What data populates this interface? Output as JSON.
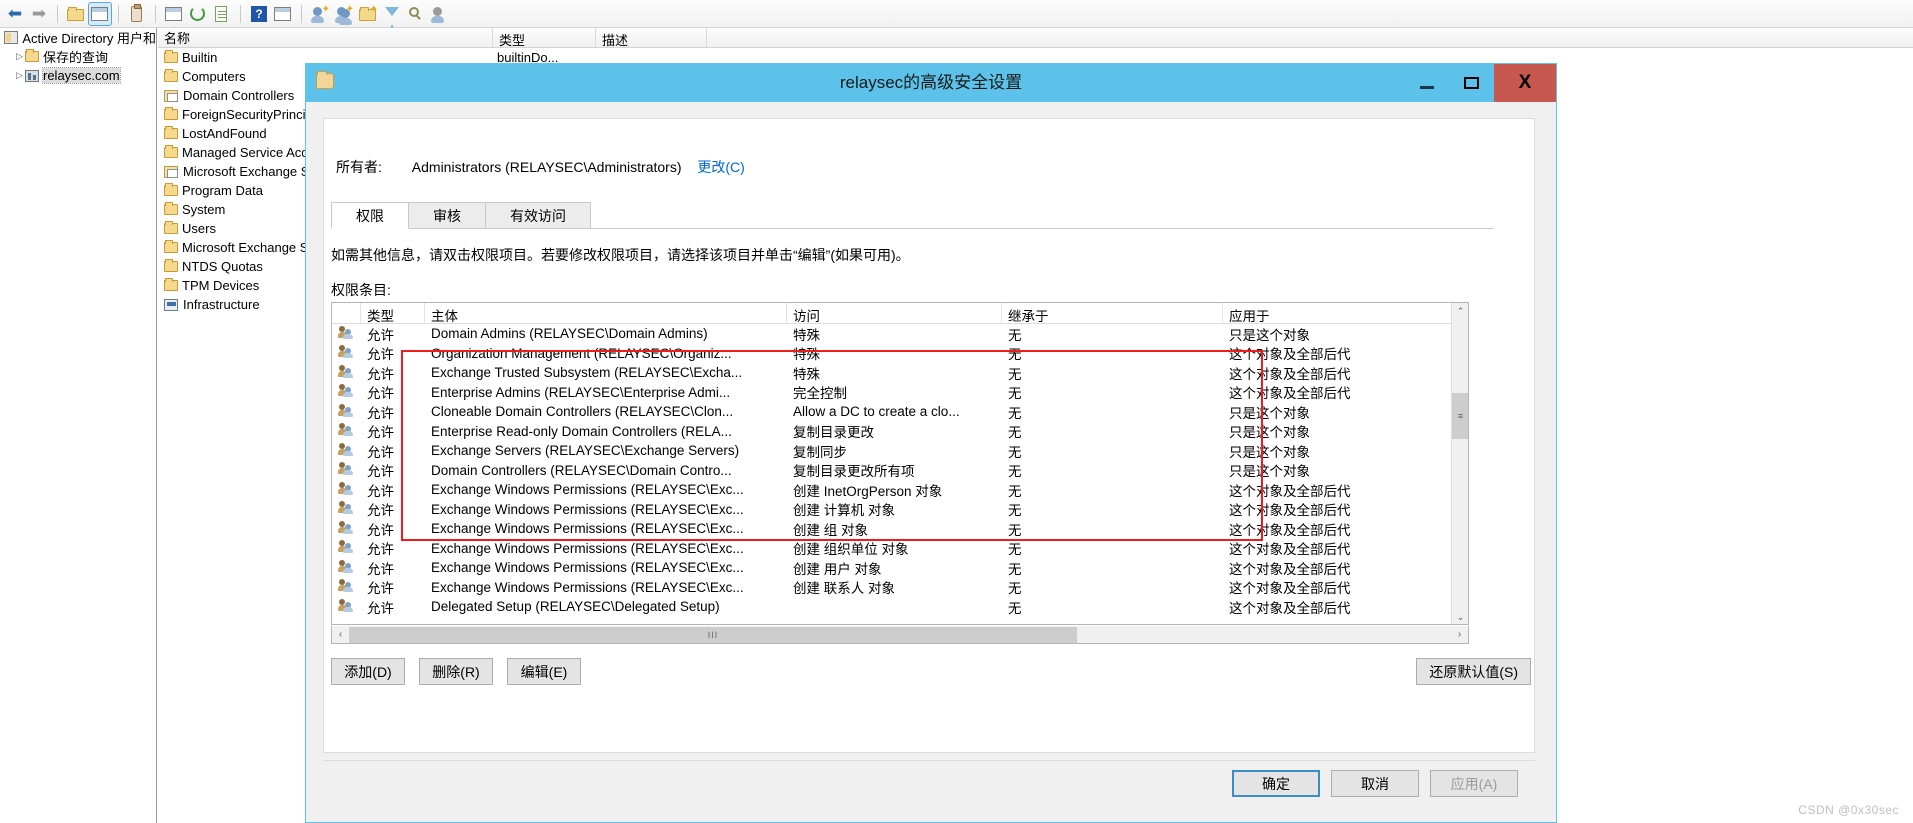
{
  "toolbar": {
    "icons": [
      "back-arrow-icon",
      "forward-arrow-icon",
      "up-folder-icon",
      "show-console-tree-icon",
      "properties-icon",
      "new-window-icon",
      "refresh-icon",
      "export-list-icon",
      "help-icon",
      "show-action-pane-icon",
      "new-user-icon",
      "new-group-icon",
      "new-ou-icon",
      "filter-icon",
      "find-icon",
      "delegate-control-icon"
    ]
  },
  "tree": {
    "items": [
      {
        "label": "Active Directory 用户和",
        "icon": "console-root-icon",
        "twisty": "",
        "level": 0,
        "selected": false
      },
      {
        "label": "保存的查询",
        "icon": "folder-icon",
        "twisty": "▷",
        "level": 1,
        "selected": false
      },
      {
        "label": "relaysec.com",
        "icon": "domain-icon",
        "twisty": "▷",
        "level": 1,
        "selected": true
      }
    ]
  },
  "listview": {
    "columns": [
      "名称",
      "类型",
      "描述"
    ],
    "rows": [
      {
        "name": "Builtin",
        "icon": "folder-icon",
        "type": "builtinDo...",
        "desc": ""
      },
      {
        "name": "Computers",
        "icon": "folder-icon",
        "type": "",
        "desc": ""
      },
      {
        "name": "Domain Controllers",
        "icon": "ou-icon",
        "type": "",
        "desc": ""
      },
      {
        "name": "ForeignSecurityPrinci",
        "icon": "folder-icon",
        "type": "",
        "desc": ""
      },
      {
        "name": "LostAndFound",
        "icon": "folder-icon",
        "type": "",
        "desc": ""
      },
      {
        "name": "Managed Service Acc",
        "icon": "folder-icon",
        "type": "",
        "desc": ""
      },
      {
        "name": "Microsoft Exchange S",
        "icon": "ou-icon",
        "type": "",
        "desc": ""
      },
      {
        "name": "Program Data",
        "icon": "folder-icon",
        "type": "",
        "desc": ""
      },
      {
        "name": "System",
        "icon": "folder-icon",
        "type": "",
        "desc": ""
      },
      {
        "name": "Users",
        "icon": "folder-icon",
        "type": "",
        "desc": ""
      },
      {
        "name": "Microsoft Exchange S",
        "icon": "folder-icon",
        "type": "",
        "desc": ""
      },
      {
        "name": "NTDS Quotas",
        "icon": "folder-icon",
        "type": "",
        "desc": ""
      },
      {
        "name": "TPM Devices",
        "icon": "folder-icon",
        "type": "",
        "desc": ""
      },
      {
        "name": "Infrastructure",
        "icon": "infrastructure-icon",
        "type": "",
        "desc": ""
      }
    ]
  },
  "dialog": {
    "title": "relaysec的高级安全设置",
    "window_buttons": {
      "minimize": "—",
      "maximize": "□",
      "close": "X"
    },
    "owner_label": "所有者:",
    "owner_value": "Administrators (RELAYSEC\\Administrators)",
    "owner_change": "更改(C)",
    "tabs": [
      {
        "label": "权限",
        "active": true
      },
      {
        "label": "审核",
        "active": false
      },
      {
        "label": "有效访问",
        "active": false
      }
    ],
    "description": "如需其他信息，请双击权限项目。若要修改权限项目，请选择该项目并单击“编辑”(如果可用)。",
    "entries_label": "权限条目:",
    "grid": {
      "columns": [
        "",
        "类型",
        "主体",
        "访问",
        "继承于",
        "应用于"
      ],
      "rows": [
        {
          "icon": "users-icon",
          "type": "允许",
          "principal": "Domain Admins (RELAYSEC\\Domain Admins)",
          "access": "特殊",
          "inherited": "无",
          "applies": "只是这个对象"
        },
        {
          "icon": "users-icon",
          "type": "允许",
          "principal": "Organization Management (RELAYSEC\\Organiz...",
          "access": "特殊",
          "inherited": "无",
          "applies": "这个对象及全部后代"
        },
        {
          "icon": "users-icon",
          "type": "允许",
          "principal": "Exchange Trusted Subsystem (RELAYSEC\\Excha...",
          "access": "特殊",
          "inherited": "无",
          "applies": "这个对象及全部后代"
        },
        {
          "icon": "users-icon",
          "type": "允许",
          "principal": "Enterprise Admins (RELAYSEC\\Enterprise Admi...",
          "access": "完全控制",
          "inherited": "无",
          "applies": "这个对象及全部后代"
        },
        {
          "icon": "users-icon",
          "type": "允许",
          "principal": "Cloneable Domain Controllers (RELAYSEC\\Clon...",
          "access": "Allow a DC to create a clo...",
          "inherited": "无",
          "applies": "只是这个对象"
        },
        {
          "icon": "users-icon",
          "type": "允许",
          "principal": "Enterprise Read-only Domain Controllers (RELA...",
          "access": "复制目录更改",
          "inherited": "无",
          "applies": "只是这个对象"
        },
        {
          "icon": "users-icon",
          "type": "允许",
          "principal": "Exchange Servers (RELAYSEC\\Exchange Servers)",
          "access": "复制同步",
          "inherited": "无",
          "applies": "只是这个对象"
        },
        {
          "icon": "users-icon",
          "type": "允许",
          "principal": "Domain Controllers (RELAYSEC\\Domain Contro...",
          "access": "复制目录更改所有项",
          "inherited": "无",
          "applies": "只是这个对象"
        },
        {
          "icon": "users-icon",
          "type": "允许",
          "principal": "Exchange Windows Permissions (RELAYSEC\\Exc...",
          "access": "创建 InetOrgPerson 对象",
          "inherited": "无",
          "applies": "这个对象及全部后代"
        },
        {
          "icon": "users-icon",
          "type": "允许",
          "principal": "Exchange Windows Permissions (RELAYSEC\\Exc...",
          "access": "创建 计算机 对象",
          "inherited": "无",
          "applies": "这个对象及全部后代"
        },
        {
          "icon": "users-icon",
          "type": "允许",
          "principal": "Exchange Windows Permissions (RELAYSEC\\Exc...",
          "access": "创建 组 对象",
          "inherited": "无",
          "applies": "这个对象及全部后代"
        },
        {
          "icon": "users-icon",
          "type": "允许",
          "principal": "Exchange Windows Permissions (RELAYSEC\\Exc...",
          "access": "创建 组织单位 对象",
          "inherited": "无",
          "applies": "这个对象及全部后代"
        },
        {
          "icon": "users-icon",
          "type": "允许",
          "principal": "Exchange Windows Permissions (RELAYSEC\\Exc...",
          "access": "创建 用户 对象",
          "inherited": "无",
          "applies": "这个对象及全部后代"
        },
        {
          "icon": "users-icon",
          "type": "允许",
          "principal": "Exchange Windows Permissions (RELAYSEC\\Exc...",
          "access": "创建 联系人 对象",
          "inherited": "无",
          "applies": "这个对象及全部后代"
        },
        {
          "icon": "users-icon",
          "type": "允许",
          "principal": "Delegated Setup (RELAYSEC\\Delegated Setup)",
          "access": "",
          "inherited": "无",
          "applies": "这个对象及全部后代"
        }
      ]
    },
    "hscroll_grip": "III",
    "buttons": {
      "add": "添加(D)",
      "remove": "删除(R)",
      "edit": "编辑(E)",
      "restore_defaults": "还原默认值(S)",
      "ok": "确定",
      "cancel": "取消",
      "apply": "应用(A)"
    }
  },
  "annotation": {
    "color": "#ee1c1c"
  },
  "watermark": "CSDN @0x30sec"
}
